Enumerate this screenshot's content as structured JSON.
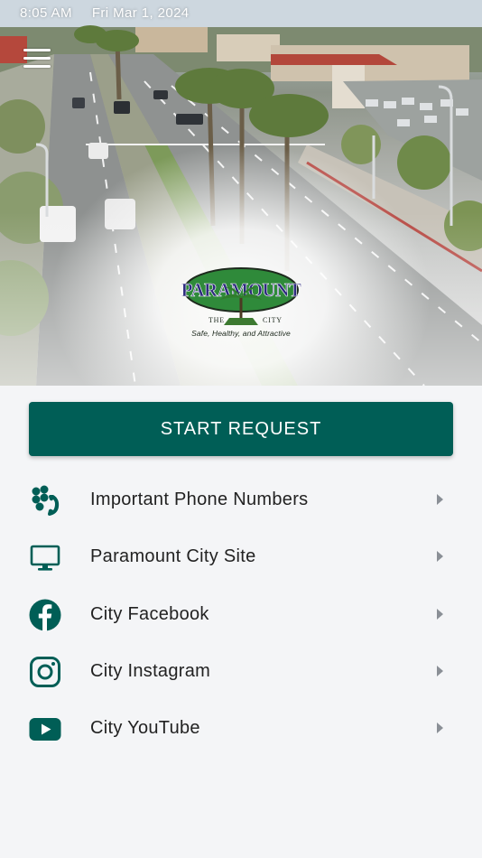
{
  "status_bar": {
    "time": "8:05 AM",
    "date": "Fri Mar 1, 2024"
  },
  "hero": {
    "logo_text": "PARAMOUNT",
    "logo_the": "THE",
    "logo_city": "CITY",
    "logo_tagline": "Safe, Healthy, and Attractive"
  },
  "start_request": {
    "label": "START REQUEST"
  },
  "menu": {
    "items": [
      {
        "label": "Important Phone Numbers",
        "icon": "phone-icon"
      },
      {
        "label": "Paramount City Site",
        "icon": "monitor-icon"
      },
      {
        "label": "City Facebook",
        "icon": "facebook-icon"
      },
      {
        "label": "City Instagram",
        "icon": "instagram-icon"
      },
      {
        "label": "City YouTube",
        "icon": "youtube-icon"
      }
    ]
  },
  "colors": {
    "primary": "#005e56",
    "icon": "#005e56",
    "background": "#f4f5f7",
    "chevron": "#8a8f96"
  }
}
